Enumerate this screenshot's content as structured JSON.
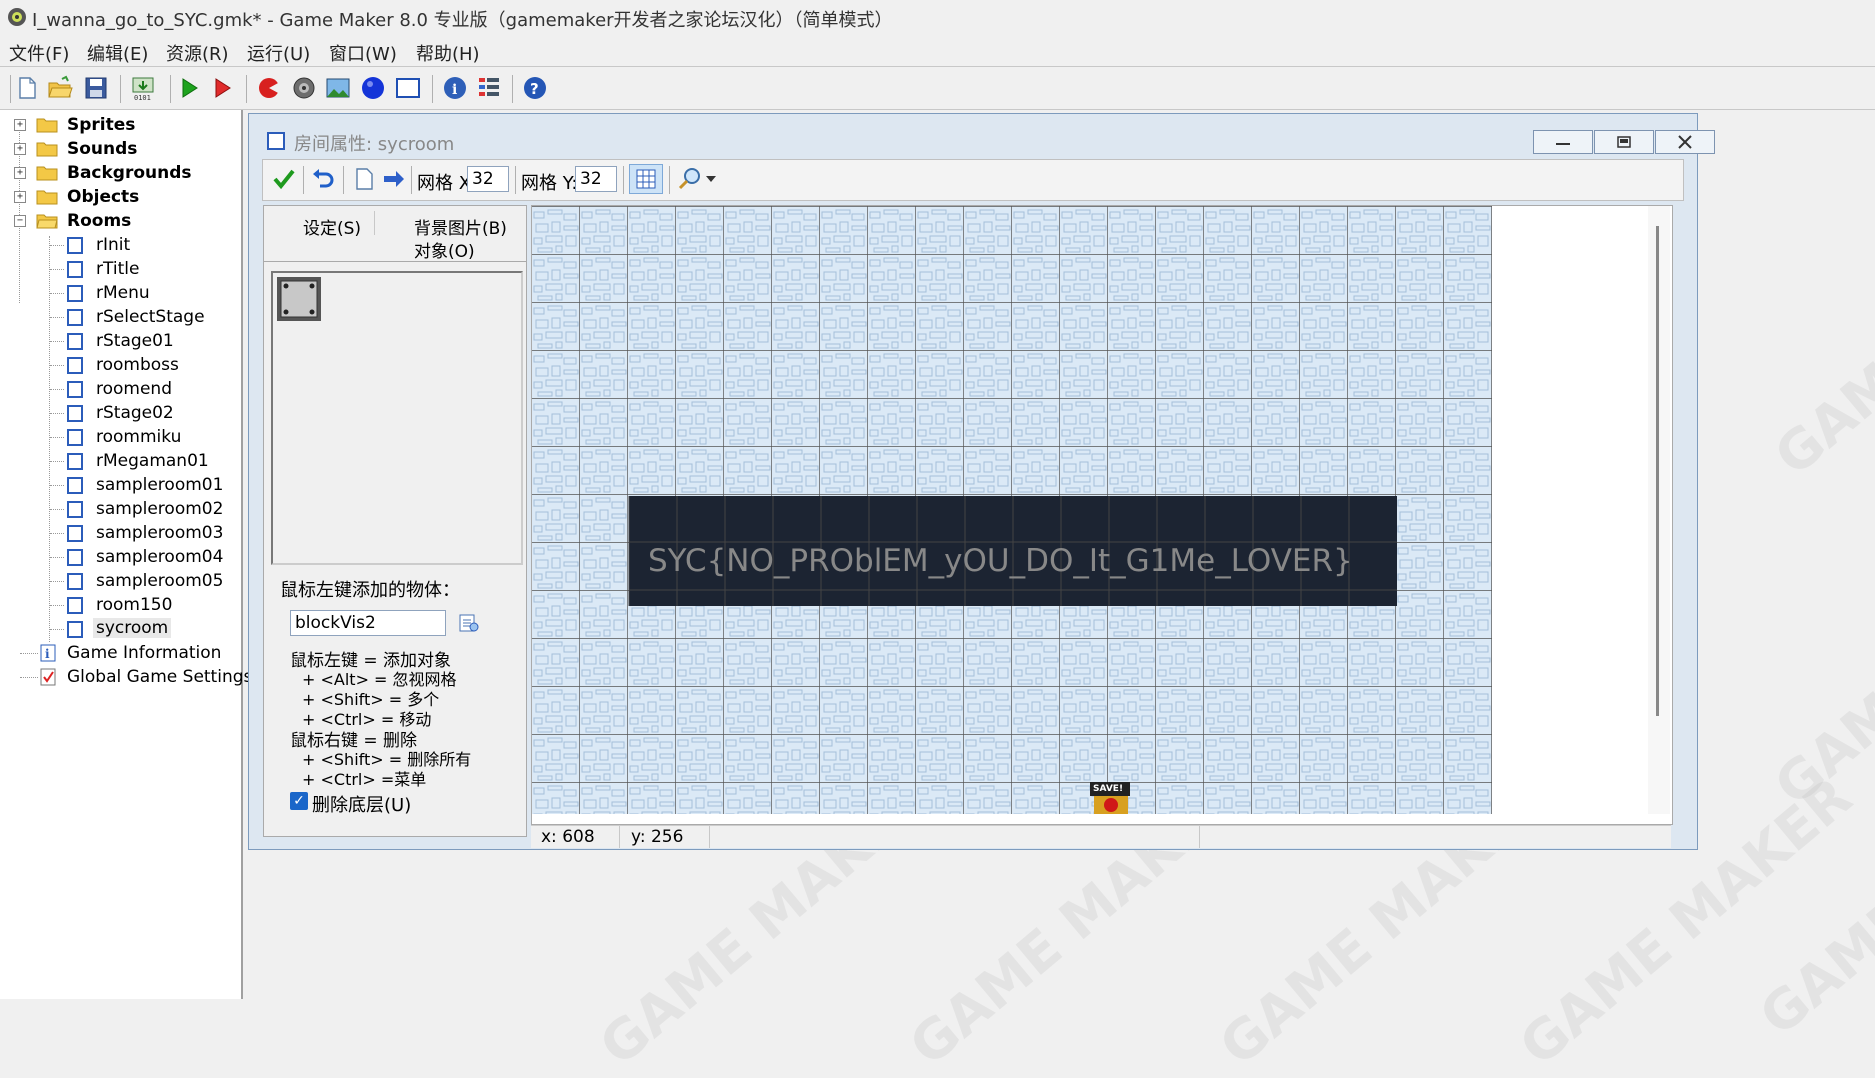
{
  "window": {
    "title": "I_wanna_go_to_SYC.gmk* - Game Maker 8.0 专业版（gamemaker开发者之家论坛汉化）（简单模式）"
  },
  "menu": [
    "文件(F)",
    "编辑(E)",
    "资源(R)",
    "运行(U)",
    "窗口(W)",
    "帮助(H)"
  ],
  "toolbar_icons": [
    "new-file-icon",
    "open-folder-icon",
    "save-icon",
    "create-executable-icon",
    "run-game-icon",
    "debug-game-icon",
    "add-sprite-icon",
    "add-sound-icon",
    "add-background-icon",
    "add-object-icon",
    "add-room-icon",
    "game-information-icon",
    "global-settings-icon",
    "help-icon"
  ],
  "tree": {
    "folders": [
      "Sprites",
      "Sounds",
      "Backgrounds",
      "Objects",
      "Rooms"
    ],
    "rooms": [
      "rInit",
      "rTitle",
      "rMenu",
      "rSelectStage",
      "rStage01",
      "roomboss",
      "roomend",
      "rStage02",
      "roommiku",
      "rMegaman01",
      "sampleroom01",
      "sampleroom02",
      "sampleroom03",
      "sampleroom04",
      "sampleroom05",
      "room150",
      "sycroom"
    ],
    "selected_room": "sycroom",
    "extras": [
      "Game Information",
      "Global Game Settings"
    ]
  },
  "room_window": {
    "title": "房间属性: sycroom",
    "grid_x_label": "网格 X:",
    "grid_x_value": "32",
    "grid_y_label": "网格 Y:",
    "grid_y_value": "32",
    "tabs": [
      "设定(S)",
      "背景图片(B)",
      "对象(O)"
    ],
    "add_object_label": "鼠标左键添加的物体：",
    "selected_object": "blockVis2",
    "help_lines": [
      "鼠标左键 = 添加对象",
      "+ <Alt> = 忽视网格",
      "+ <Shift> = 多个",
      "+ <Ctrl> = 移动",
      "鼠标右键 = 删除",
      "+ <Shift> = 删除所有",
      "+ <Ctrl> =菜单"
    ],
    "delete_underlying_label": "删除底层(U)",
    "delete_underlying_checked": true,
    "canvas_text": "SYC{NO_PROblEM_yOU_DO_It_G1Me_LOVER}",
    "save_label": "SAVE!",
    "status_x": "x: 608",
    "status_y": "y: 256"
  },
  "watermark": "GAME MAKER"
}
